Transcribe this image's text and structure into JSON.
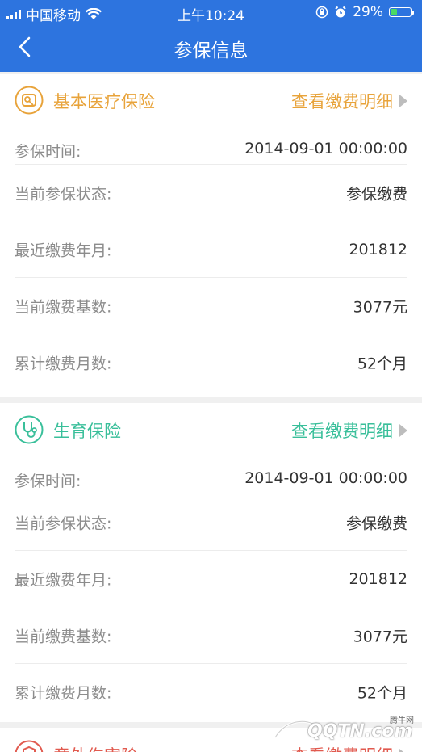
{
  "status_bar": {
    "carrier": "中国移动",
    "time": "上午10:24",
    "battery": "29%",
    "battery_level": 0.29,
    "signal_icon": "signal-bars-icon",
    "wifi_icon": "wifi-icon",
    "alarm_icon": "alarm-icon",
    "lock_icon": "orientation-lock-icon"
  },
  "nav": {
    "title": "参保信息",
    "back_icon": "back-chevron-icon"
  },
  "cards": [
    {
      "title": "基本医疗保险",
      "link": "查看缴费明细",
      "accent": "#e8a33a",
      "icon": "medical-insurance-icon",
      "rows": [
        {
          "label": "参保时间:",
          "value": "2014-09-01 00:00:00"
        },
        {
          "label": "当前参保状态:",
          "value": "参保缴费"
        },
        {
          "label": "最近缴费年月:",
          "value": "201812"
        },
        {
          "label": "当前缴费基数:",
          "value": "3077元"
        },
        {
          "label": "累计缴费月数:",
          "value": "52个月"
        }
      ]
    },
    {
      "title": "生育保险",
      "link": "查看缴费明细",
      "accent": "#39bf9a",
      "icon": "stethoscope-icon",
      "rows": [
        {
          "label": "参保时间:",
          "value": "2014-09-01 00:00:00"
        },
        {
          "label": "当前参保状态:",
          "value": "参保缴费"
        },
        {
          "label": "最近缴费年月:",
          "value": "201812"
        },
        {
          "label": "当前缴费基数:",
          "value": "3077元"
        },
        {
          "label": "累计缴费月数:",
          "value": "52个月"
        }
      ]
    },
    {
      "title": "意外伤害险",
      "link": "查看缴费明细",
      "accent": "#e15a4f",
      "icon": "injury-insurance-icon",
      "rows": []
    }
  ],
  "watermark": {
    "text": "QQTN.com",
    "subtext": "腾牛网"
  },
  "colors": {
    "header": "#2d74df",
    "background": "#f0f0f0",
    "label": "#8c8c8c",
    "value": "#333333"
  }
}
